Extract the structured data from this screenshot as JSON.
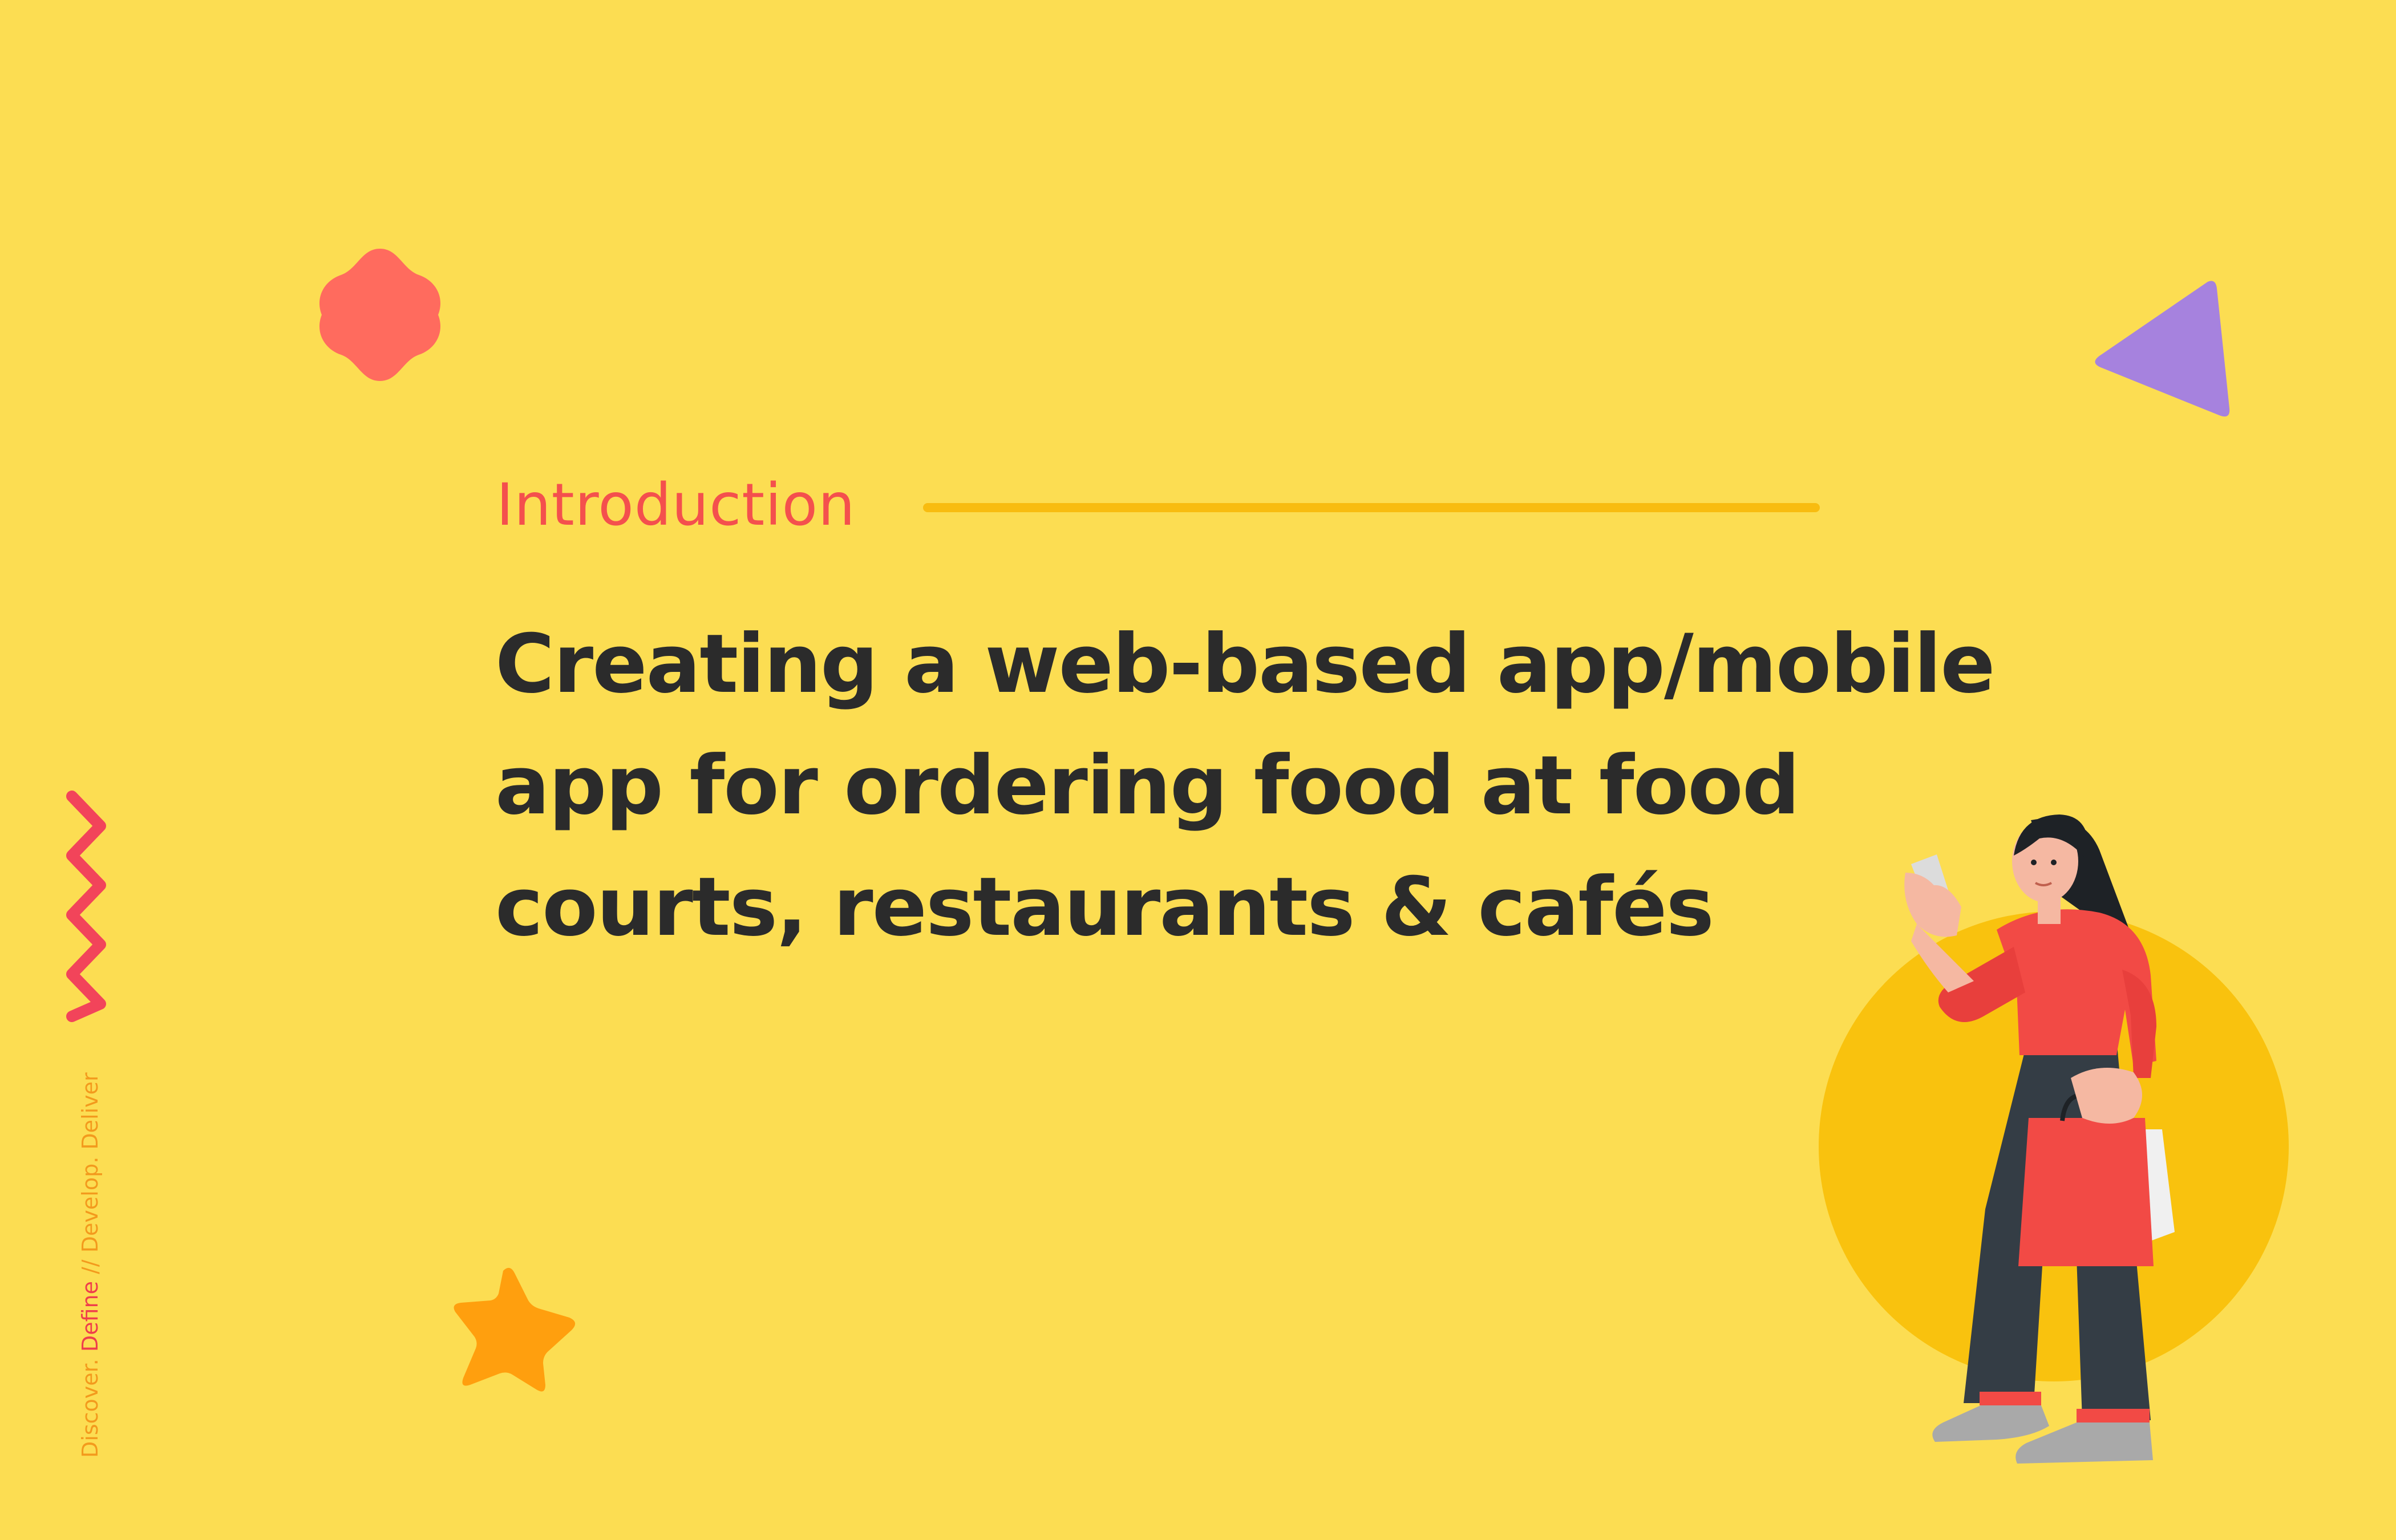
{
  "colors": {
    "background": "#FCDD52",
    "accent_red": "#F4504D",
    "accent_orange": "#F39A1D",
    "rule_yellow": "#F8BC10",
    "text_dark": "#2B2B2B",
    "blob_coral": "#FF6B5E",
    "triangle_purple": "#A682DE",
    "zigzag_red": "#F2445A",
    "star_orange": "#FF9F0E",
    "circle_yellow": "#F9C20E"
  },
  "intro": {
    "section_label": "Introduction",
    "headline_lines": [
      "Creating a web-based app/mobile",
      "app for ordering food at food",
      "courts, restaurants & cafés"
    ]
  },
  "phase_nav": {
    "discover": "Discover.",
    "define": "Define",
    "separator": "//",
    "develop": "Develop.",
    "deliver": "Deliver",
    "active": "Define"
  },
  "icons": [
    "flower-blob-icon",
    "triangle-icon",
    "zigzag-icon",
    "star-icon",
    "woman-shopping-illustration"
  ]
}
